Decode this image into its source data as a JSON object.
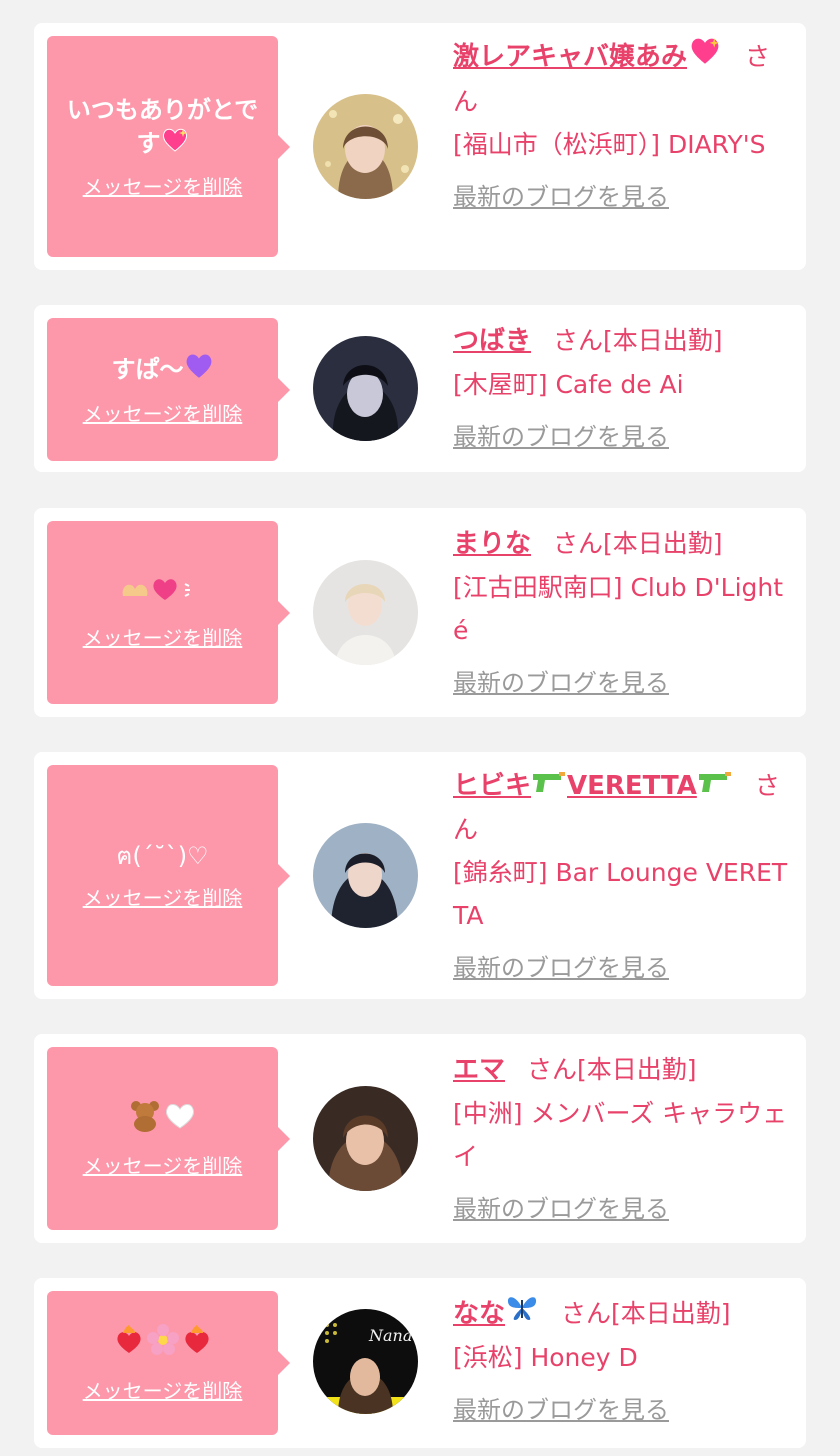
{
  "colors": {
    "page_bg": "#f2f2f2",
    "card_bg": "#ffffff",
    "bubble_bg": "#fd98ab",
    "accent_pink": "#e8426b",
    "link_gray": "#9a9a9a"
  },
  "labels": {
    "delete_message": "メッセージを削除",
    "view_latest_blog": "最新のブログを見る",
    "honorific": "さん"
  },
  "cards": [
    {
      "message": "いつもありがとです",
      "message_icon": "sparkling-heart-icon",
      "cast_name": "激レアキャバ嬢あみ",
      "name_icon": "sparkling-heart-icon",
      "status": "",
      "location": "[福山市（松浜町）] DIARY'S"
    },
    {
      "message": "すぱ〜",
      "message_icon": "purple-heart-icon",
      "cast_name": "つばき",
      "name_icon": "",
      "status": "[本日出勤]",
      "location": "[木屋町] Cafe de Ai"
    },
    {
      "message": "",
      "message_icon": "heart-hands-heart-icon",
      "cast_name": "まりな",
      "name_icon": "",
      "status": "[本日出勤]",
      "location": "[江古田駅南口] Club D'Lighté"
    },
    {
      "message": "ฅ(´˘`)♡",
      "message_icon": "",
      "cast_name": "ヒビキ",
      "name_icon": "water-pistol-icon",
      "name_suffix": "VERETTA",
      "status": "",
      "location": "[錦糸町] Bar Lounge VERETTA"
    },
    {
      "message": "",
      "message_icon": "teddy-bear-white-heart-icon",
      "cast_name": "エマ",
      "name_icon": "",
      "status": "[本日出勤]",
      "location": "[中洲] メンバーズ キャラウェイ"
    },
    {
      "message": "",
      "message_icon": "fire-heart-blossom-icon",
      "cast_name": "なな",
      "name_icon": "butterfly-icon",
      "status": "[本日出勤]",
      "location": "[浜松] Honey D"
    }
  ]
}
